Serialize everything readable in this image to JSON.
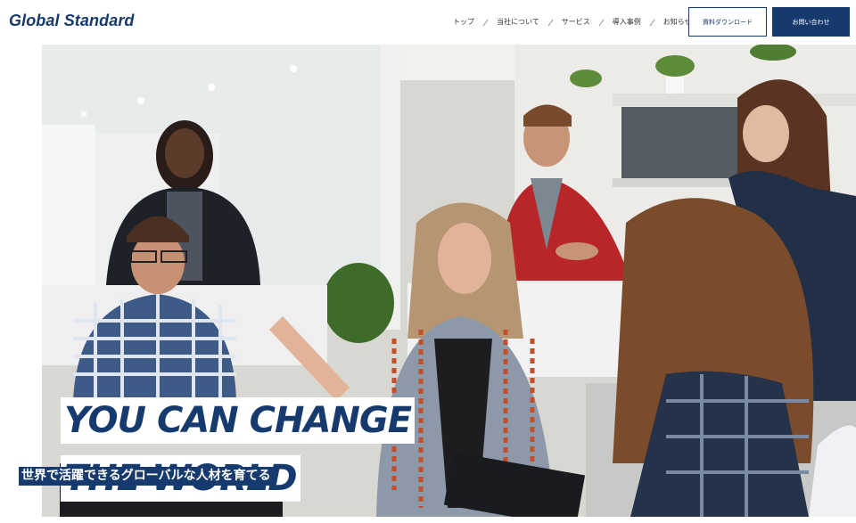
{
  "header": {
    "logo": "Global Standard",
    "nav": [
      {
        "label": "トップ"
      },
      {
        "label": "当社について"
      },
      {
        "label": "サービス"
      },
      {
        "label": "導入事例"
      },
      {
        "label": "お知らせ"
      }
    ],
    "download_button": "資料ダウンロード",
    "contact_button": "お問い合わせ"
  },
  "hero": {
    "headline_line1": "YOU CAN CHANGE",
    "headline_line2": "THE WORLD",
    "subheadline": "世界で活躍できるグローバルな人材を育てる"
  },
  "colors": {
    "brand": "#163a6e",
    "background": "#ffffff"
  }
}
